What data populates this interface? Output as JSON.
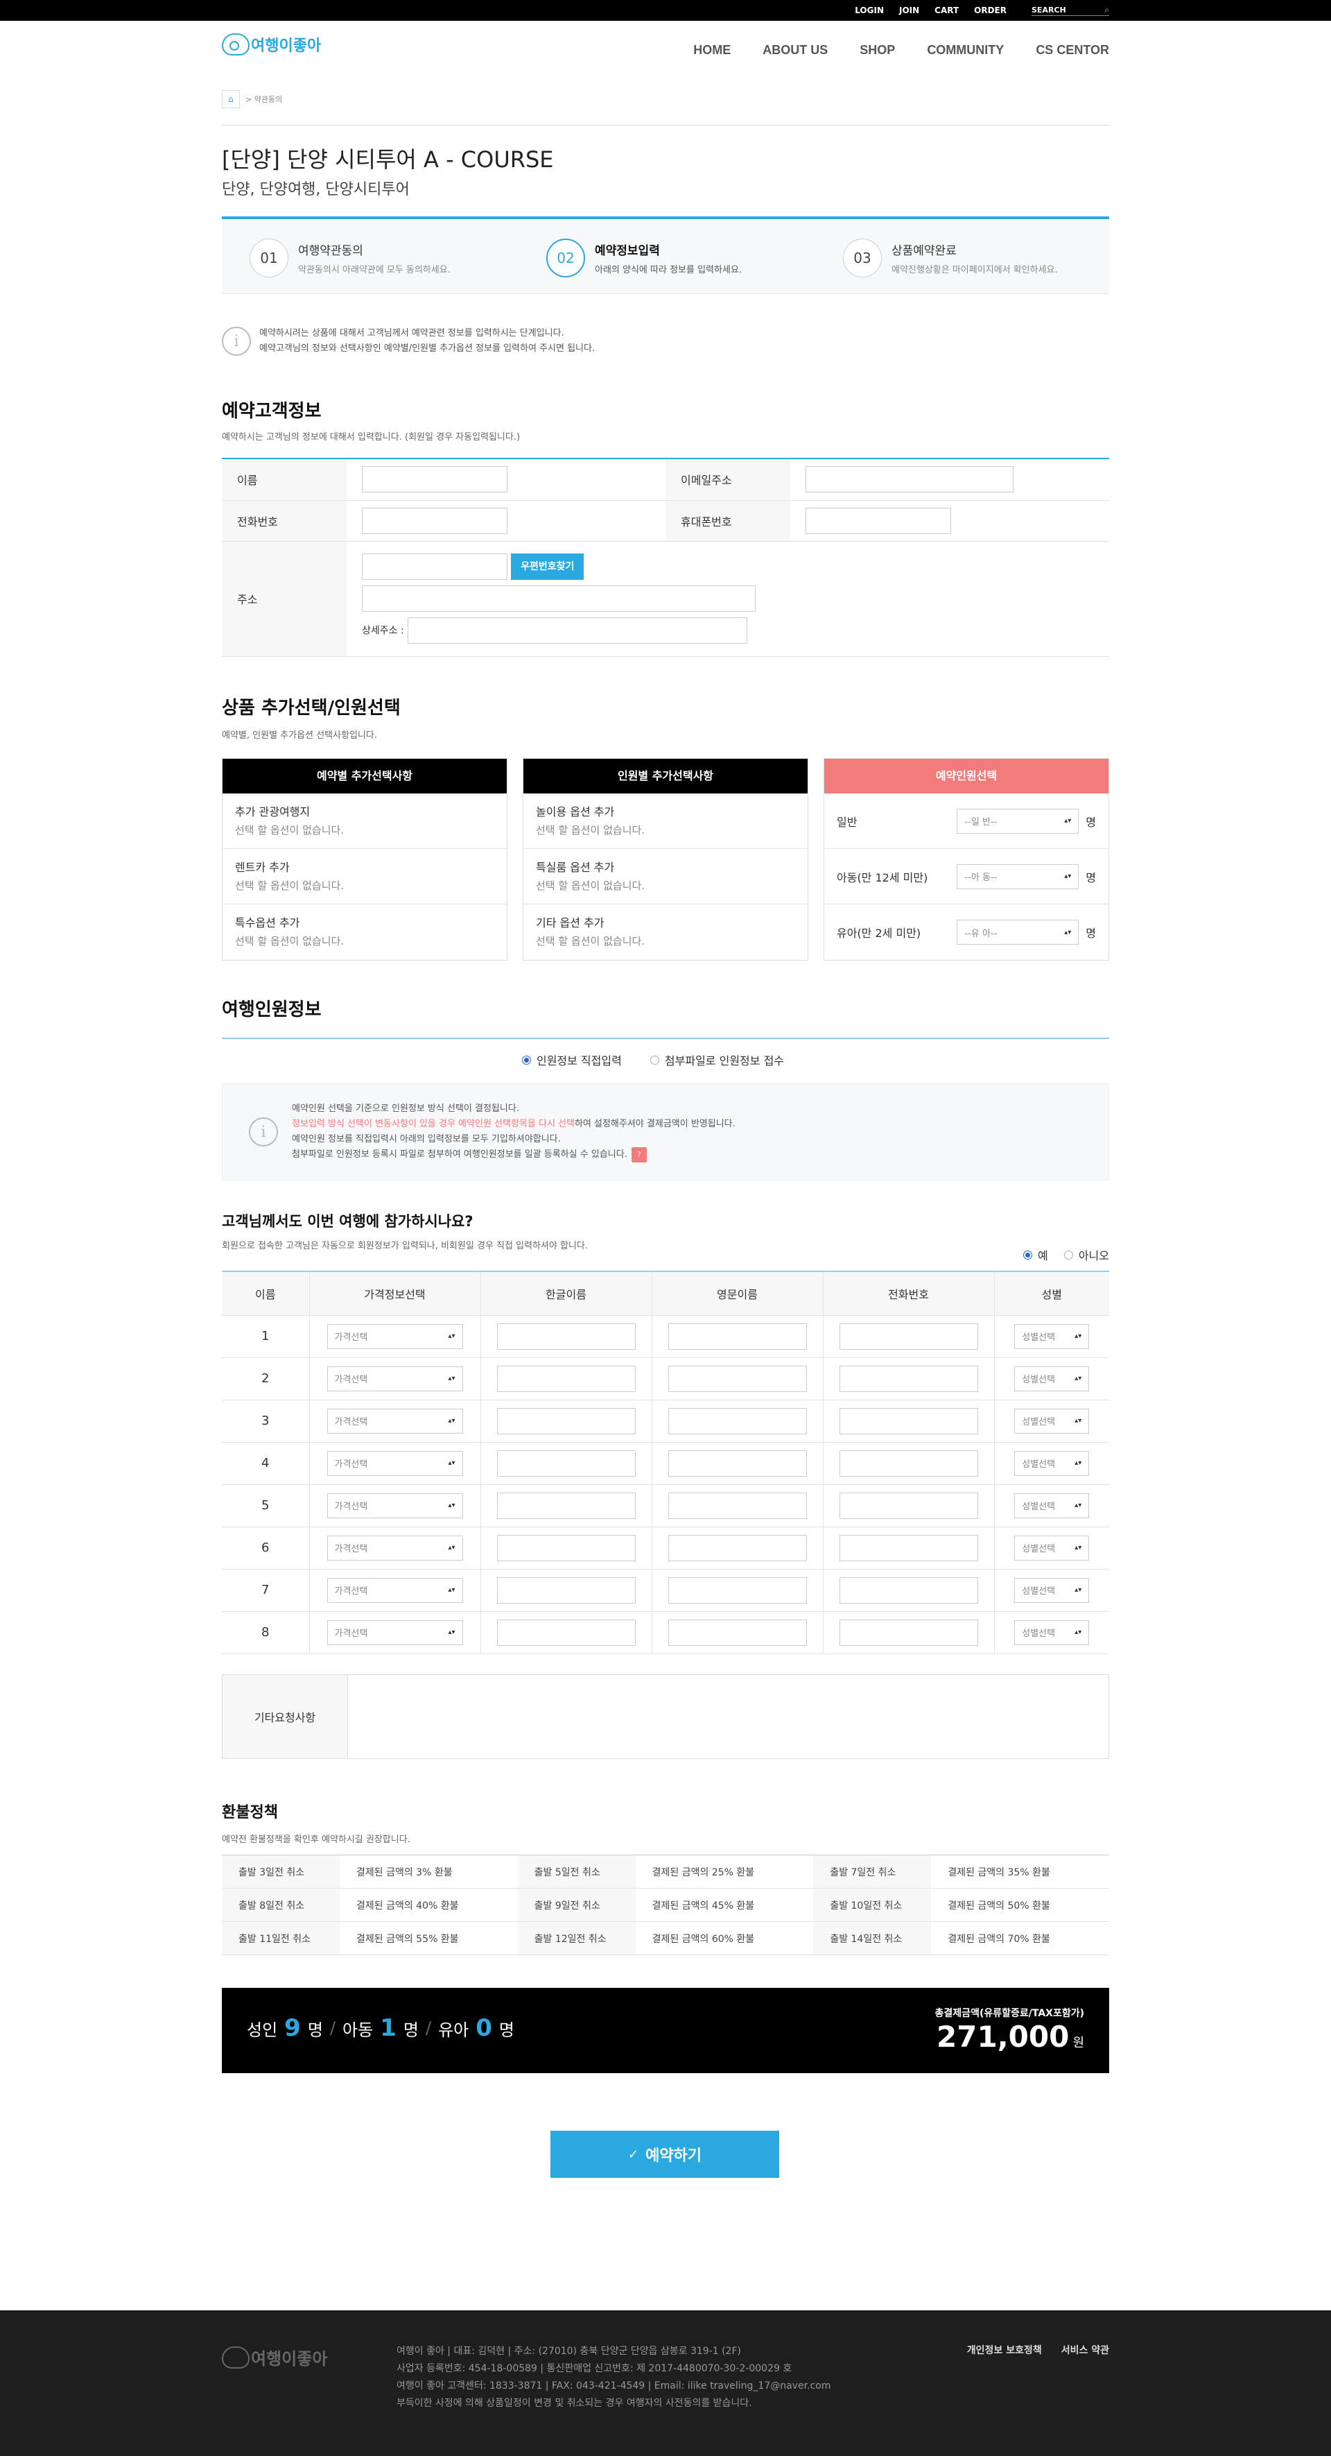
{
  "topbar": {
    "links": [
      "LOGIN",
      "JOIN",
      "CART",
      "ORDER"
    ],
    "search_label": "SEARCH"
  },
  "logo": {
    "text": "여행이좋아"
  },
  "gnb": [
    "HOME",
    "ABOUT US",
    "SHOP",
    "COMMUNITY",
    "CS CENTOR"
  ],
  "breadcrumb": {
    "current": "> 약관동의"
  },
  "page": {
    "title": "[단양] 단양 시티투어 A - COURSE",
    "tags": "단양, 단양여행, 단양시티투어"
  },
  "steps": [
    {
      "num": "01",
      "title": "여행약관동의",
      "desc": "약관동의시 아래약관에 모두 동의하세요."
    },
    {
      "num": "02",
      "title": "예약정보입력",
      "desc": "아래의 양식에 따라 정보를 입력하세요."
    },
    {
      "num": "03",
      "title": "상품예약완료",
      "desc": "예약진행상황은 마이페이지에서 확인하세요."
    }
  ],
  "notice1": {
    "line1": "예약하시려는 상품에 대해서 고객님께서 예약관련 정보를 입력하시는 단계입니다.",
    "line2": "예약고객님의 정보와 선택사항인 예약별/인원별 추가옵션 정보를 입력하여 주시면 됩니다."
  },
  "customer": {
    "title": "예약고객정보",
    "desc": "예약하시는 고객님의 정보에 대해서 입력합니다. (회원일 경우 자동입력됩니다.)",
    "name": "이름",
    "email": "이메일주소",
    "phone": "전화번호",
    "mobile": "휴대폰번호",
    "address": "주소",
    "zip_button": "우편번호찾기",
    "detail_address": "상세주소 :"
  },
  "options": {
    "title": "상품 추가선택/인원선택",
    "desc": "예약별, 인원별 추가옵션 선택사항입니다.",
    "col1": {
      "header": "예약별 추가선택사항",
      "items": [
        {
          "name": "추가 관광여행지",
          "note": "선택 할 옵션이 없습니다."
        },
        {
          "name": "렌트카 추가",
          "note": "선택 할 옵션이 없습니다."
        },
        {
          "name": "특수옵션 추가",
          "note": "선택 할 옵션이 없습니다."
        }
      ]
    },
    "col2": {
      "header": "인원별 추가선택사항",
      "items": [
        {
          "name": "놀이용 옵션 추가",
          "note": "선택 할 옵션이 없습니다."
        },
        {
          "name": "특실룸 옵션 추가",
          "note": "선택 할 옵션이 없습니다."
        },
        {
          "name": "기타 옵션 추가",
          "note": "선택 할 옵션이 없습니다."
        }
      ]
    },
    "col3": {
      "header": "예약인원선택",
      "unit": "명",
      "items": [
        {
          "label": "일반",
          "select": "--일 반--"
        },
        {
          "label": "아동(만 12세 미만)",
          "select": "--아 동--"
        },
        {
          "label": "유아(만 2세 미만)",
          "select": "--유 아--"
        }
      ]
    }
  },
  "traveler": {
    "title": "여행인원정보",
    "radio1": "인원정보 직접입력",
    "radio2": "첨부파일로 인원정보 접수",
    "n1": "예약인원 선택을 기준으로 인원정보 방식 선택이 결정됩니다.",
    "n2_red": "정보입력 방식 선택이 변동사항이 있을 경우 예약인원 선택항목을 다시 선택",
    "n2_rest": "하여 설정해주셔야 결제금액이 반영됩니다.",
    "n3": "예약인원 정보를 직접입력시 아래의 입력정보를 모두 기입하셔야합니다.",
    "n4": "첨부파일로 인원정보 등록시 파일로 첨부하여 여행인원정보를 일괄 등록하실 수 있습니다.",
    "badge": "?"
  },
  "participate": {
    "title": "고객님께서도 이번 여행에 참가하시나요?",
    "desc": "회원으로 접속한 고객님은 자동으로 회원정보가 입력되나, 비회원일 경우 직접 입력하셔야 합니다.",
    "yes": "예",
    "no": "아니오",
    "headers": [
      "이름",
      "가격정보선택",
      "한글이름",
      "영문이름",
      "전화번호",
      "성별"
    ],
    "rows": [
      "1",
      "2",
      "3",
      "4",
      "5",
      "6",
      "7",
      "8"
    ],
    "price_select": "가격선택",
    "gender_select": "성별선택"
  },
  "etc": {
    "label": "기타요청사항"
  },
  "refund": {
    "title": "환불정책",
    "desc": "예약전 환불정책을 확인후 예약하시길 권장합니다.",
    "rows": [
      [
        {
          "k": "출발 3일전 취소",
          "v": "결제된 금액의 3% 환불"
        },
        {
          "k": "출발 5일전 취소",
          "v": "결제된 금액의 25% 환불"
        },
        {
          "k": "출발 7일전 취소",
          "v": "결제된 금액의 35% 환불"
        }
      ],
      [
        {
          "k": "출발 8일전 취소",
          "v": "결제된 금액의 40% 환불"
        },
        {
          "k": "출발 9일전 취소",
          "v": "결제된 금액의 45% 환불"
        },
        {
          "k": "출발 10일전 취소",
          "v": "결제된 금액의 50% 환불"
        }
      ],
      [
        {
          "k": "출발 11일전 취소",
          "v": "결제된 금액의 55% 환불"
        },
        {
          "k": "출발 12일전 취소",
          "v": "결제된 금액의 60% 환불"
        },
        {
          "k": "출발 14일전 취소",
          "v": "결제된 금액의 70% 환불"
        }
      ]
    ]
  },
  "total": {
    "adult_label": "성인",
    "adult_count": "9",
    "child_label": "아동",
    "child_count": "1",
    "infant_label": "유아",
    "infant_count": "0",
    "unit": "명",
    "sep": "/",
    "amount_label": "총결제금액(유류할증료/TAX포함가)",
    "amount": "271,000",
    "won": "원"
  },
  "submit": {
    "label": "예약하기",
    "icon": "✓"
  },
  "footer": {
    "lines": [
      "여행이 좋아 | 대표: 김덕현 | 주소: (27010) 충북 단양군 단양읍 삼봉로 319-1 (2F)",
      "사업자 등록번호: 454-18-00589 | 통신판매업 신고번호: 제 2017-4480070-30-2-00029 호",
      "여행이 좋아 고객센터: 1833-3871 | FAX: 043-421-4549 | Email: ilike traveling_17@naver.com",
      "부득이한 사정에 의해 상품일정이 변경 및 취소되는 경우 여행자의 사전동의를 받습니다."
    ],
    "links": [
      "개인정보 보호정책",
      "서비스 약관"
    ]
  }
}
